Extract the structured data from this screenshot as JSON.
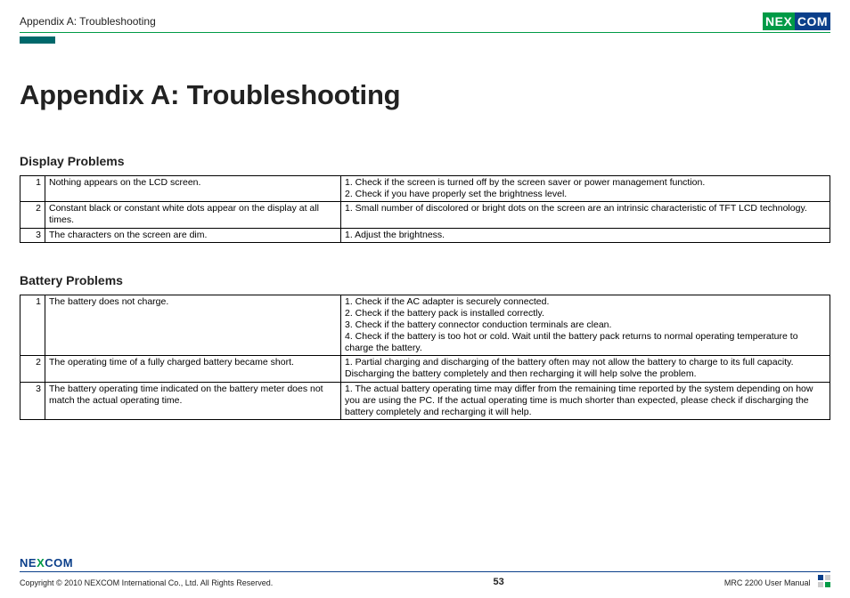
{
  "header": {
    "breadcrumb": "Appendix A: Troubleshooting",
    "logo_left": "NE",
    "logo_x": "X",
    "logo_right": "COM"
  },
  "title": "Appendix A: Troubleshooting",
  "sections": [
    {
      "heading": "Display Problems",
      "rows": [
        {
          "n": "1",
          "problem": "Nothing appears on the LCD screen.",
          "solution": "1. Check if the screen is turned off by the screen saver or power management function.\n2. Check if you have properly set the brightness level."
        },
        {
          "n": "2",
          "problem": "Constant black or constant white dots appear on the display at all times.",
          "solution": "1. Small number of discolored or bright dots on the screen are an intrinsic characteristic of TFT LCD technology."
        },
        {
          "n": "3",
          "problem": "The characters on the screen are dim.",
          "solution": "1. Adjust the brightness."
        }
      ]
    },
    {
      "heading": "Battery Problems",
      "rows": [
        {
          "n": "1",
          "problem": "The battery does not charge.",
          "solution": "1. Check if the AC adapter is securely connected.\n2. Check if the battery pack is installed correctly.\n3. Check if the battery connector conduction terminals are clean.\n4. Check if the battery is too hot or cold. Wait until the battery pack returns to normal operating temperature to charge the battery."
        },
        {
          "n": "2",
          "problem": "The operating time of a fully charged battery became short.",
          "solution": "1. Partial charging and discharging of the battery often may not allow the battery to charge to its full capacity. Discharging the battery completely and then recharging it will help solve the problem."
        },
        {
          "n": "3",
          "problem": "The battery operating time indicated on the battery meter does not match the actual operating time.",
          "solution": "1. The actual battery operating time may differ from the remaining time reported by the system depending on how you are using the PC. If the actual operating time is much shorter than expected, please check if discharging the battery completely and recharging it will help."
        }
      ]
    }
  ],
  "footer": {
    "logo_left": "NE",
    "logo_x": "X",
    "logo_right": "COM",
    "copyright": "Copyright © 2010 NEXCOM International Co., Ltd. All Rights Reserved.",
    "page": "53",
    "manual": "MRC 2200 User Manual"
  }
}
